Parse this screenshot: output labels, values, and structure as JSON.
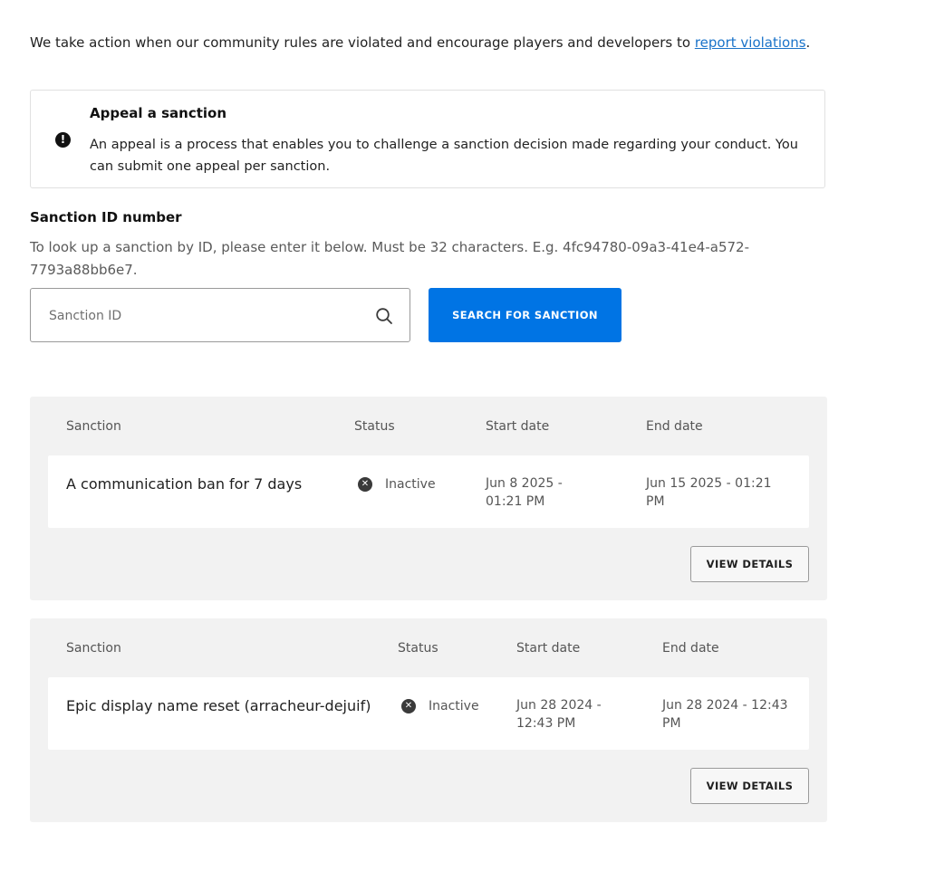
{
  "intro": {
    "text": "We take action when our community rules are violated and encourage players and developers to ",
    "link_text": "report violations",
    "suffix": "."
  },
  "appeal": {
    "icon": "exclamation-circle-icon",
    "title": "Appeal a sanction",
    "text": "An appeal is a process that enables you to challenge a sanction decision made regarding your conduct. You can submit one appeal per sanction."
  },
  "lookup": {
    "label": "Sanction ID number",
    "help": "To look up a sanction by ID, please enter it below. Must be 32 characters. E.g. 4fc94780-09a3-41e4-a572-7793a88bb6e7.",
    "placeholder": "Sanction ID",
    "value": "",
    "search_icon": "search-icon",
    "button_label": "SEARCH FOR SANCTION"
  },
  "colors": {
    "accent": "#0074e4",
    "link": "#1a73c9",
    "card_bg": "#f2f2f2"
  },
  "sanctions": [
    {
      "headers": {
        "sanction": "Sanction",
        "status": "Status",
        "start": "Start date",
        "end": "End date"
      },
      "name": "A communication ban for 7 days",
      "status_icon": "x-circle-icon",
      "status": "Inactive",
      "start_line1": "Jun 8 2025 -",
      "start_line2": "01:21 PM",
      "end_line1": "Jun 15 2025 - 01:21",
      "end_line2": "PM",
      "button_label": "VIEW DETAILS"
    },
    {
      "headers": {
        "sanction": "Sanction",
        "status": "Status",
        "start": "Start date",
        "end": "End date"
      },
      "name": "Epic display name reset (arracheur-dejuif)",
      "status_icon": "x-circle-icon",
      "status": "Inactive",
      "start_line1": "Jun 28 2024 -",
      "start_line2": "12:43 PM",
      "end_line1": "Jun 28 2024 - 12:43",
      "end_line2": "PM",
      "button_label": "VIEW DETAILS"
    }
  ]
}
